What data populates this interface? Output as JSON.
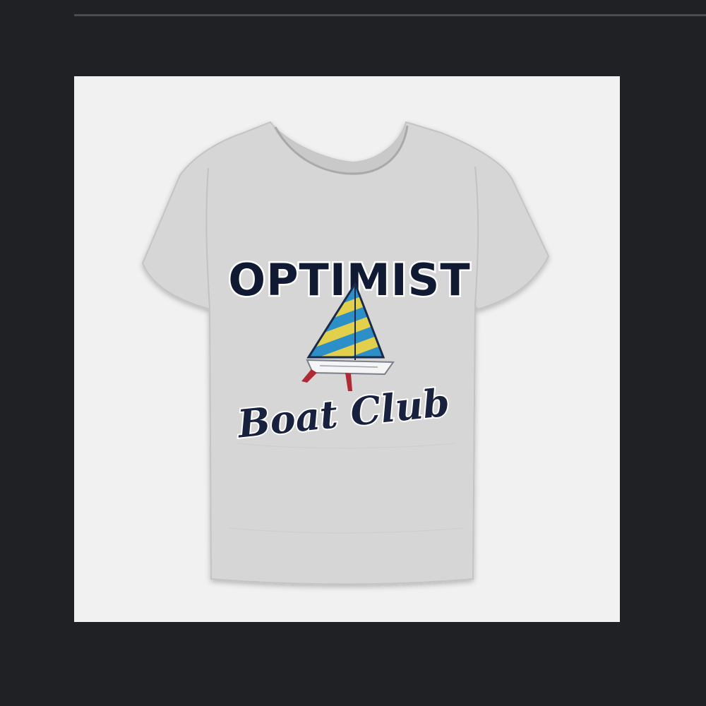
{
  "viewer": {
    "background": "#202124",
    "divider_color": "#4a4c50"
  },
  "product": {
    "frame_background": "#f1f1f1",
    "shirt_color": "#d6d6d6",
    "graphic": {
      "title": "OPTIMIST",
      "subtitle": "Boat Club",
      "title_color": "#101a33",
      "sail_colors": [
        "#2d8fc7",
        "#e2d04c"
      ],
      "hull_color": "#f5f5f5",
      "hull_accent": "#b02a36"
    }
  }
}
